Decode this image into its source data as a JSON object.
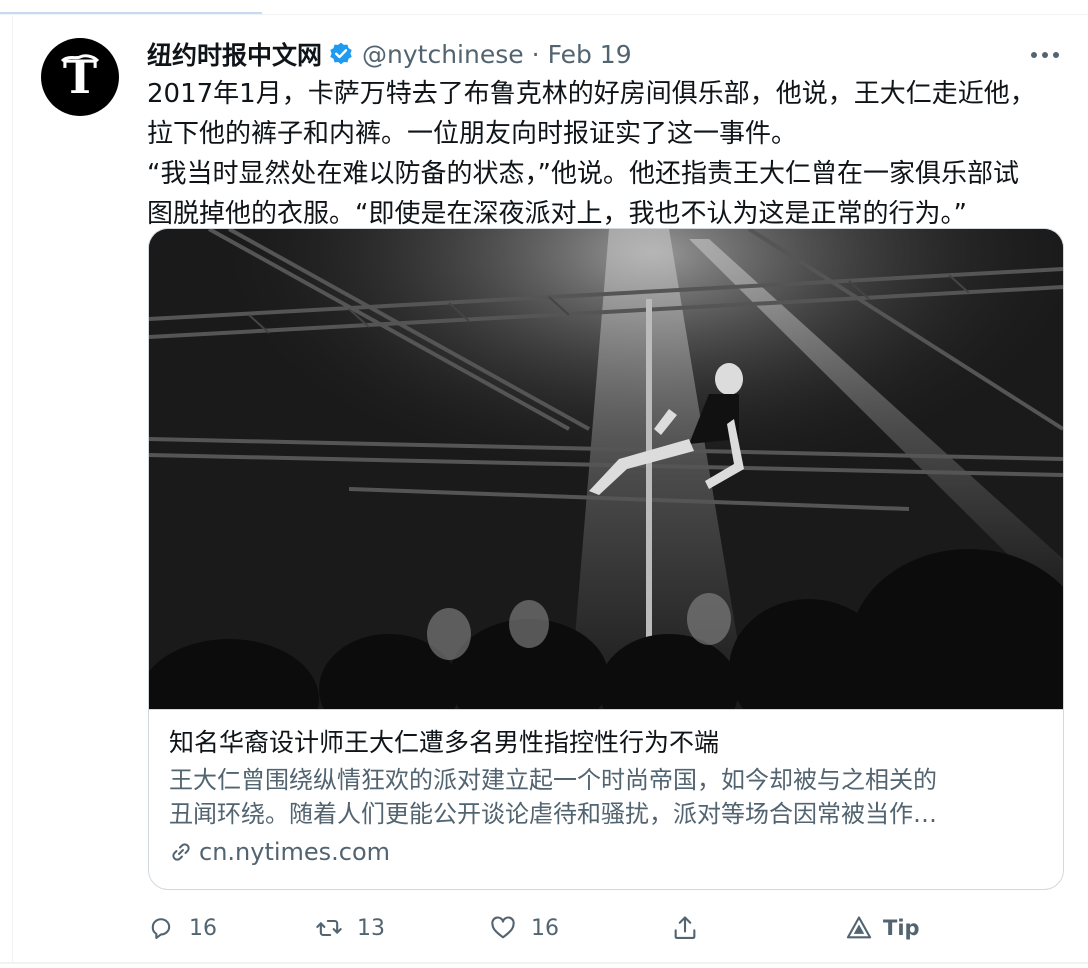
{
  "tweet": {
    "author_name": "纽约时报中文网",
    "handle": "@nytchinese",
    "separator": "·",
    "date": "Feb 19",
    "text_lines": [
      "2017年1月，卡萨万特去了布鲁克林的好房间俱乐部，他说，王大仁走近他，",
      "拉下他的裤子和内裤。一位朋友向时报证实了这一事件。",
      "“我当时显然处在难以防备的状态，”他说。他还指责王大仁曾在一家俱乐部试",
      "图脱掉他的衣服。“即使是在深夜派对上，我也不认为这是正常的行为。”"
    ]
  },
  "card": {
    "title": "知名华裔设计师王大仁遭多名男性指控性行为不端",
    "description_lines": [
      "王大仁曾围绕纵情狂欢的派对建立起一个时尚帝国，如今却被与之相关的",
      "丑闻环绕。随着人们更能公开谈论虐待和骚扰，派对等场合因常被当作…"
    ],
    "domain": "cn.nytimes.com"
  },
  "actions": {
    "reply_count": "16",
    "retweet_count": "13",
    "like_count": "16",
    "tip_label": "Tip"
  },
  "icons": {
    "avatar": "nyt-logo-icon",
    "verified": "verified-badge-icon",
    "more": "more-icon",
    "link": "link-icon",
    "reply": "reply-icon",
    "retweet": "retweet-icon",
    "like": "like-icon",
    "share": "share-icon",
    "tip": "tip-icon"
  },
  "colors": {
    "verified_blue": "#1d9bf0",
    "secondary_text": "#536471",
    "primary_text": "#0f1419",
    "card_border": "#cfd9de"
  }
}
